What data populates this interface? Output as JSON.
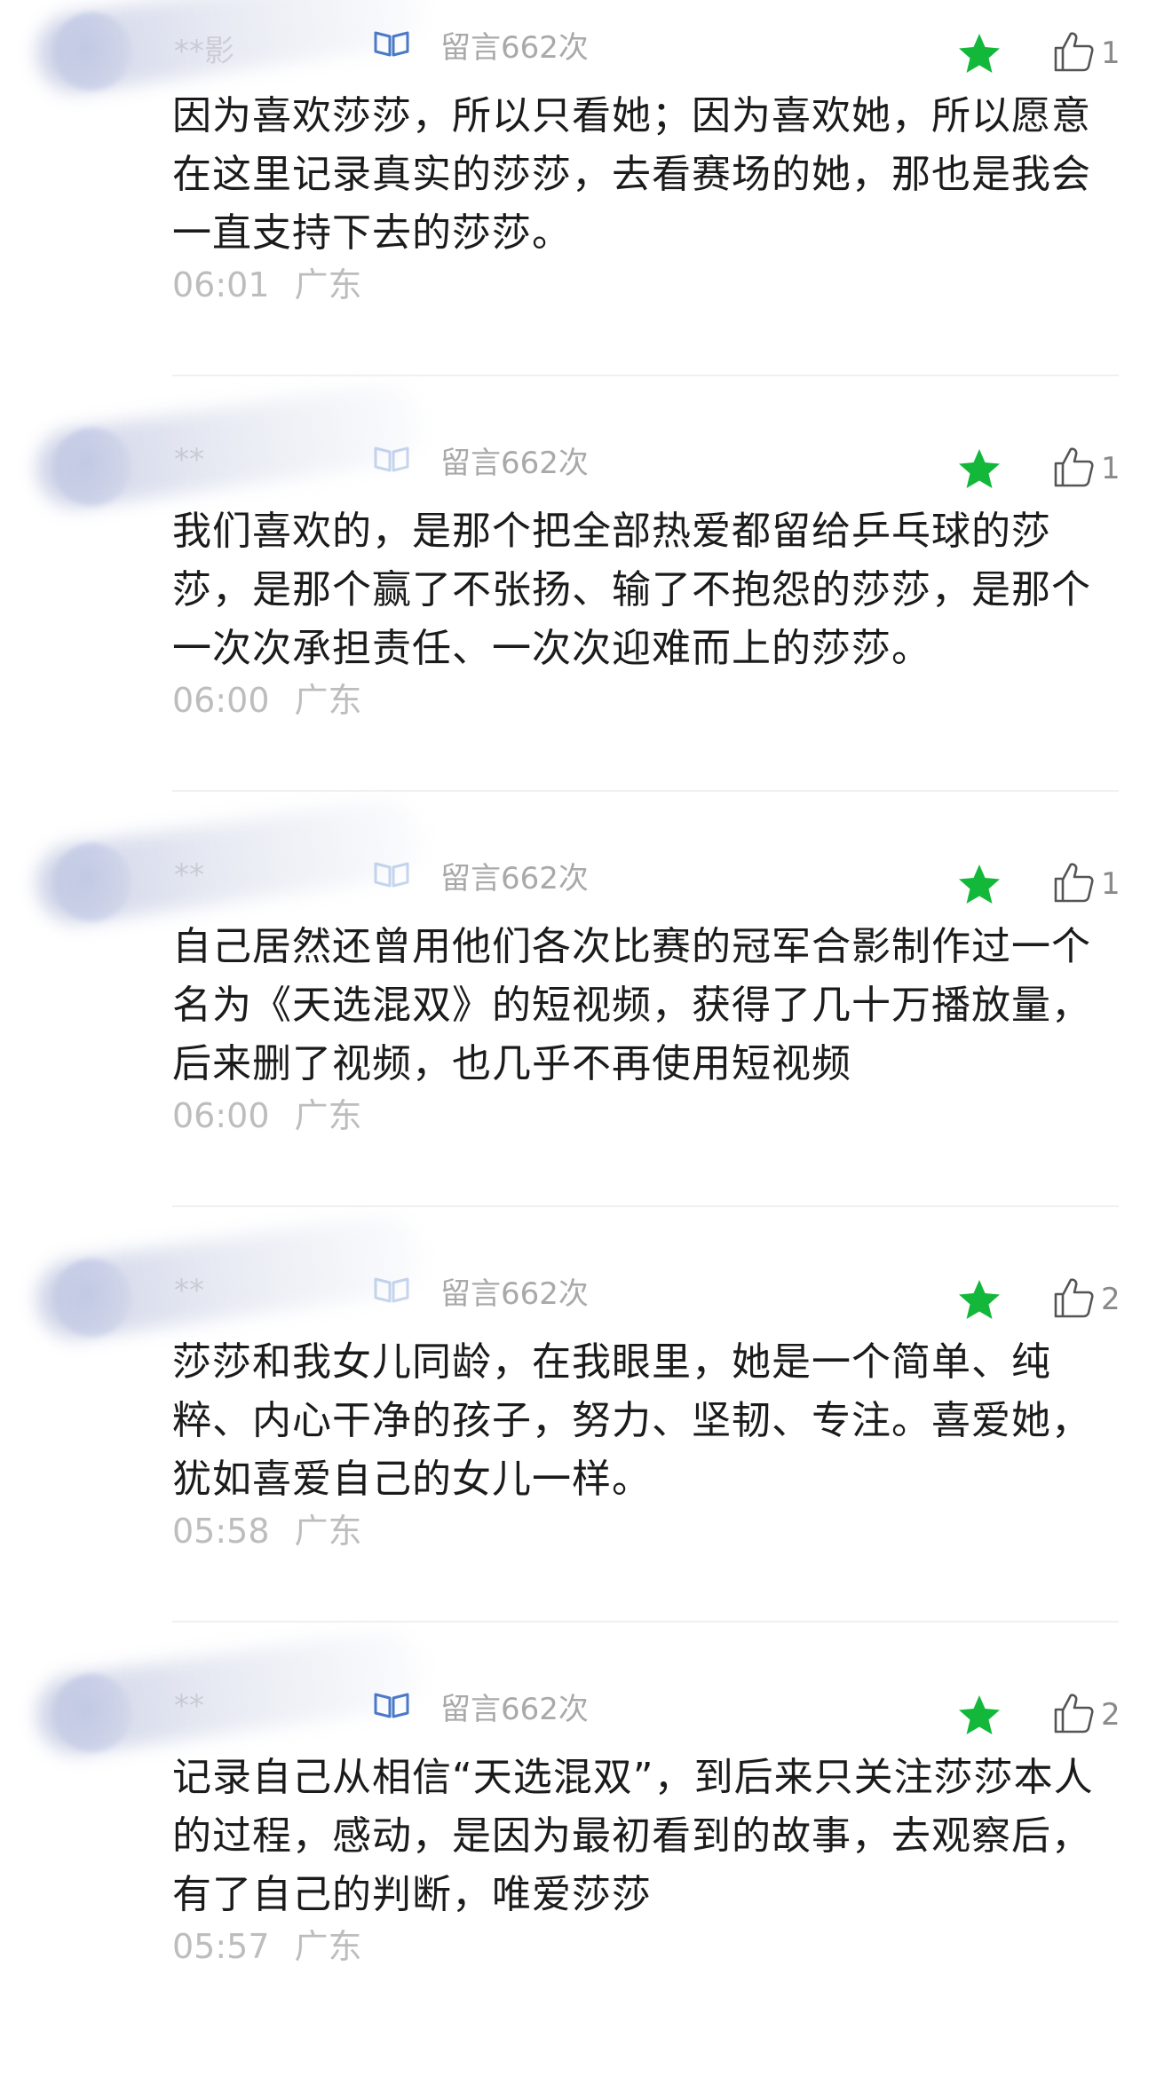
{
  "comments": [
    {
      "user": "**影",
      "comment_count": "留言662次",
      "likes": "1",
      "text": "因为喜欢莎莎，所以只看她；因为喜欢她，所以愿意在这里记录真实的莎莎，去看赛场的她，那也是我会一直支持下去的莎莎。",
      "time": "06:01",
      "location": "广东"
    },
    {
      "user": "**",
      "comment_count": "留言662次",
      "likes": "1",
      "text": "我们喜欢的，是那个把全部热爱都留给乒乓球的莎莎，是那个赢了不张扬、输了不抱怨的莎莎，是那个一次次承担责任、一次次迎难而上的莎莎。",
      "time": "06:00",
      "location": "广东"
    },
    {
      "user": "**",
      "comment_count": "留言662次",
      "likes": "1",
      "text": "自己居然还曾用他们各次比赛的冠军合影制作过一个名为《天选混双》的短视频，获得了几十万播放量，后来删了视频，也几乎不再使用短视频",
      "time": "06:00",
      "location": "广东"
    },
    {
      "user": "**",
      "comment_count": "留言662次",
      "likes": "2",
      "text": "莎莎和我女儿同龄，在我眼里，她是一个简单、纯粹、内心干净的孩子，努力、坚韧、专注。喜爱她，犹如喜爱自己的女儿一样。",
      "time": "05:58",
      "location": "广东"
    },
    {
      "user": "**",
      "comment_count": "留言662次",
      "likes": "2",
      "text": "记录自己从相信“天选混双”，到后来只关注莎莎本人的过程，感动，是因为最初看到的故事，去观察后，有了自己的判断，唯爱莎莎",
      "time": "05:57",
      "location": "广东"
    }
  ],
  "colors": {
    "star": "#13b83b",
    "badge": "#4a79c7",
    "meta_text": "#bdbdbd",
    "body_text": "#1b1b1b"
  },
  "icons": {
    "star": "star-icon",
    "like": "thumbs-up-icon",
    "badge": "book-badge-icon"
  }
}
